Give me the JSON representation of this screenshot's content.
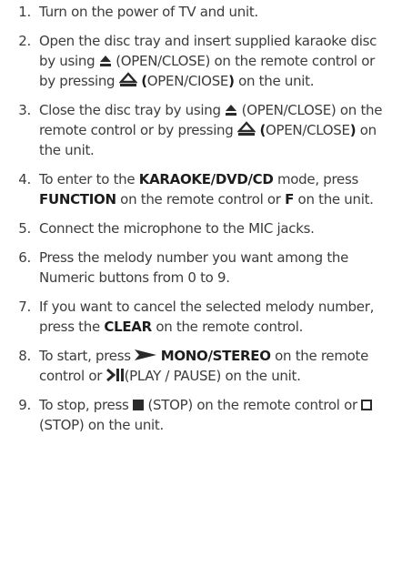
{
  "steps": [
    {
      "number": "1.",
      "parts": [
        "Turn on the power of TV and unit."
      ]
    },
    {
      "number": "2.",
      "parts": [
        "Open the disc tray and insert supplied karaoke disc by using ",
        " (OPEN/CLOSE) on the remote control or by pressing ",
        "(",
        "OPEN/CIOSE",
        ")",
        " on the unit."
      ]
    },
    {
      "number": "3.",
      "parts": [
        "Close the disc tray by using ",
        " (OPEN/CLOSE) on the remote control or by pressing ",
        "(",
        "OPEN/CLOSE",
        ")",
        " on the unit."
      ]
    },
    {
      "number": "4.",
      "parts": [
        "To enter to the ",
        "KARAOKE/DVD/CD",
        " mode, press ",
        "FUNCTION",
        " on the remote control or ",
        "F",
        " on the unit."
      ]
    },
    {
      "number": "5.",
      "parts": [
        "Connect the microphone to the MIC jacks."
      ]
    },
    {
      "number": "6.",
      "parts": [
        "Press the melody number you want among the Numeric buttons from 0 to 9."
      ]
    },
    {
      "number": "7.",
      "parts": [
        "If you want to cancel the selected melody number, press the ",
        "CLEAR",
        " on the remote control."
      ]
    },
    {
      "number": "8.",
      "parts": [
        "To start, press ",
        "MONO/STEREO",
        " on the remote control or ",
        "(PLAY / PAUSE) on the unit."
      ]
    },
    {
      "number": "9.",
      "parts": [
        "To stop, press ",
        " (STOP) on the remote control or ",
        " (STOP) on the unit."
      ]
    }
  ],
  "icons": {
    "eject_remote": "eject-solid-icon",
    "eject_unit": "eject-outline-icon",
    "play": "play-icon",
    "play_pause": "play-pause-icon",
    "stop_remote": "stop-solid-icon",
    "stop_unit": "stop-outline-icon"
  },
  "colors": {
    "text": "#3c3c3c",
    "bold_text": "#1d1d1d",
    "icon": "#2a2a2a"
  }
}
